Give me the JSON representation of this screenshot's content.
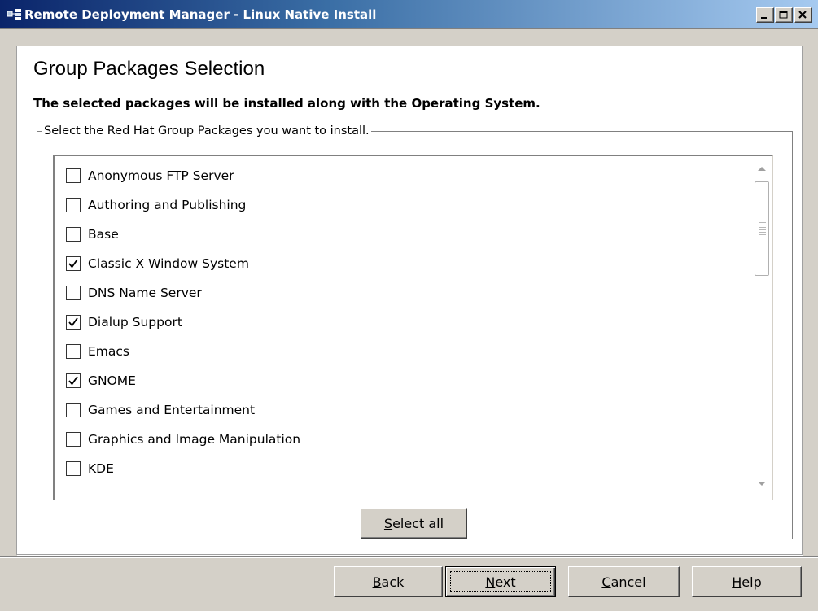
{
  "window": {
    "title": "Remote Deployment Manager - Linux Native Install"
  },
  "page": {
    "heading": "Group Packages Selection",
    "subheading": "The selected packages will be installed along with the Operating System.",
    "group_legend": "Select the Red Hat Group Packages you want to install."
  },
  "packages": [
    {
      "label": "Anonymous FTP Server",
      "checked": false
    },
    {
      "label": "Authoring and Publishing",
      "checked": false
    },
    {
      "label": "Base",
      "checked": false
    },
    {
      "label": "Classic X Window System",
      "checked": true
    },
    {
      "label": "DNS Name Server",
      "checked": false
    },
    {
      "label": "Dialup Support",
      "checked": true
    },
    {
      "label": "Emacs",
      "checked": false
    },
    {
      "label": "GNOME",
      "checked": true
    },
    {
      "label": "Games and Entertainment",
      "checked": false
    },
    {
      "label": "Graphics and Image Manipulation",
      "checked": false
    },
    {
      "label": "KDE",
      "checked": false
    }
  ],
  "buttons": {
    "select_all": {
      "mnemonic": "S",
      "rest": "elect all"
    },
    "back": {
      "mnemonic": "B",
      "rest": "ack"
    },
    "next": {
      "mnemonic": "N",
      "rest": "ext"
    },
    "cancel": {
      "mnemonic": "C",
      "rest": "ancel"
    },
    "help": {
      "mnemonic": "H",
      "rest": "elp"
    }
  },
  "icons": {
    "app": "rdm-app-icon",
    "minimize": "minimize-icon",
    "maximize": "maximize-icon",
    "close": "close-icon",
    "scroll_up": "arrow-up-icon",
    "scroll_down": "arrow-down-icon",
    "check": "checkmark-icon"
  }
}
